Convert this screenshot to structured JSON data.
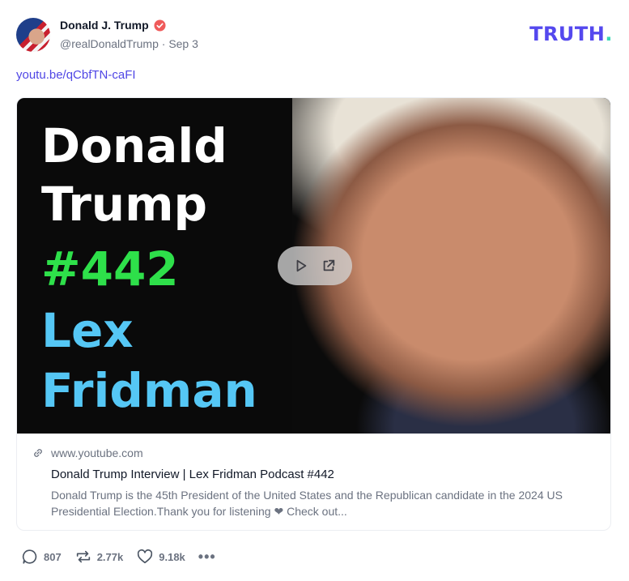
{
  "post": {
    "author_name": "Donald J. Trump",
    "handle": "@realDonaldTrump",
    "separator": " · ",
    "date": "Sep 3",
    "link_text": "youtu.be/qCbfTN-caFI"
  },
  "brand": {
    "logo_main": "TRUTH",
    "logo_dot": ".",
    "colors": {
      "logo": "#5448ee",
      "logo_dot": "#3ad9b5"
    }
  },
  "thumbnail": {
    "line1": "Donald",
    "line2": "Trump",
    "line3": "#442",
    "line4": "Lex",
    "line5": "Fridman",
    "colors": {
      "white": "#ffffff",
      "green": "#2ee04a",
      "blue": "#55c7f5"
    }
  },
  "card": {
    "domain": "www.youtube.com",
    "title": "Donald Trump Interview | Lex Fridman Podcast #442",
    "description": "Donald Trump is the 45th President of the United States and the Republican candidate in the 2024 US Presidential Election.Thank you for listening ❤ Check out..."
  },
  "actions": {
    "replies": "807",
    "reposts": "2.77k",
    "likes": "9.18k",
    "more": "•••"
  },
  "icons": {
    "verified": "verified-badge-icon",
    "play": "play-icon",
    "external": "external-link-icon",
    "link": "link-icon",
    "reply": "reply-icon",
    "repost": "repost-icon",
    "like": "heart-icon",
    "more": "more-icon"
  }
}
